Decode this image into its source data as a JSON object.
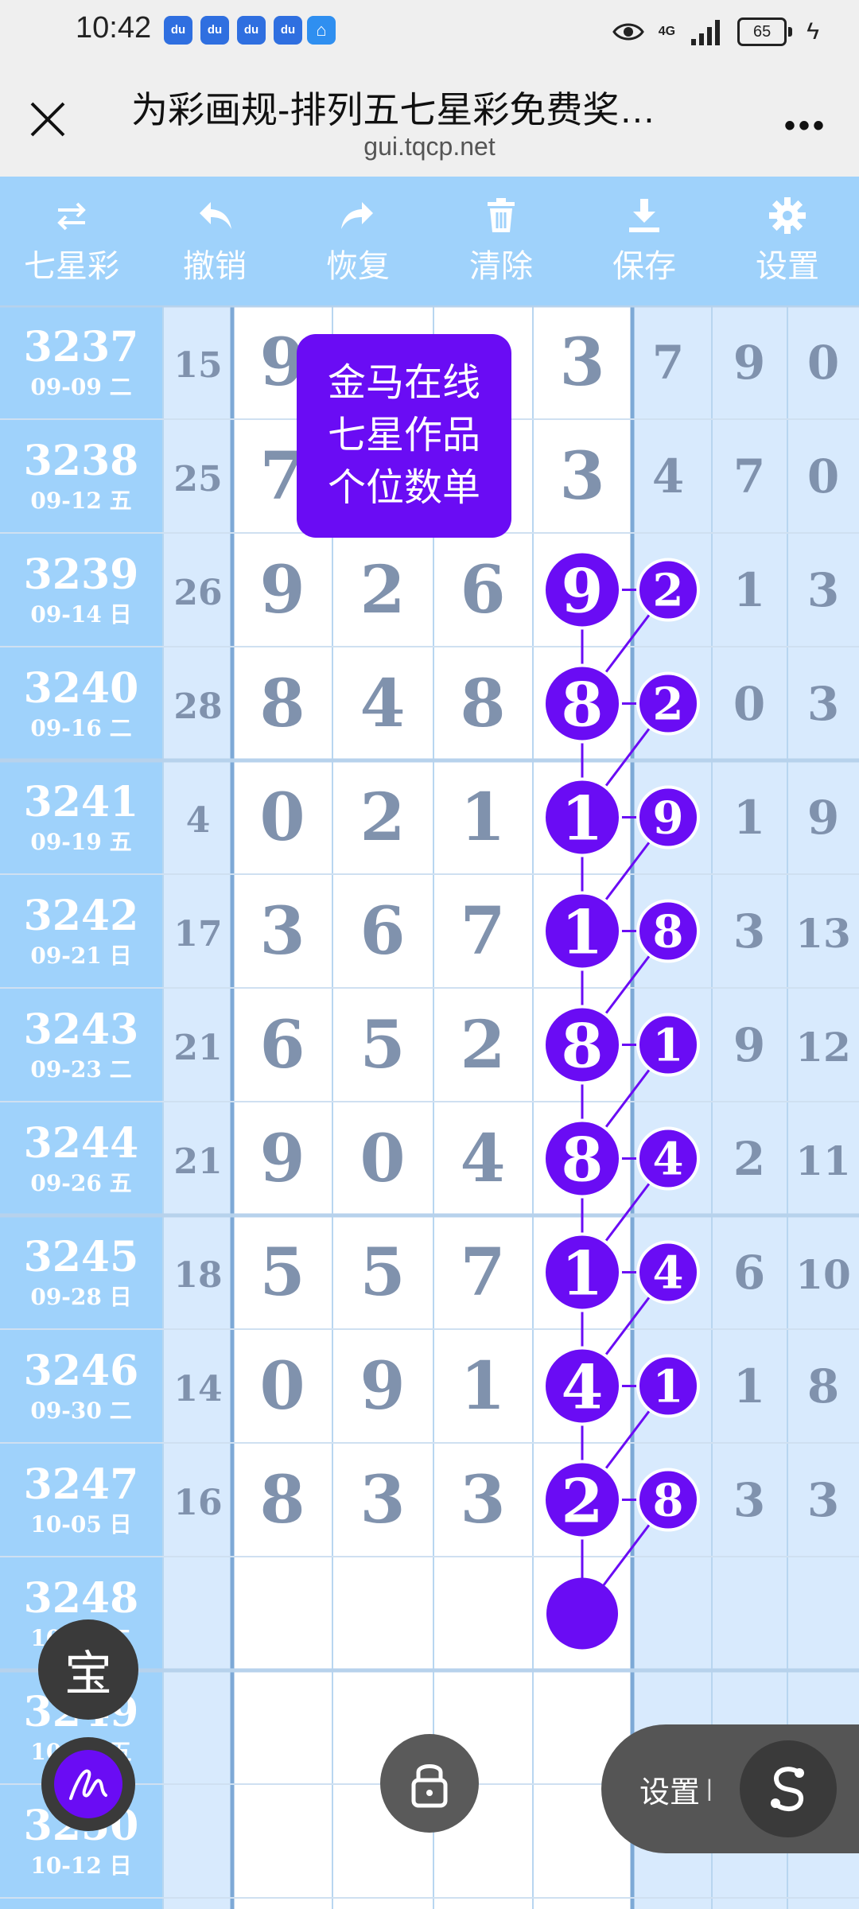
{
  "status_bar": {
    "time": "10:42",
    "notification_icons": [
      "baidu-app-icon",
      "baidu-app-icon",
      "baidu-app-icon",
      "baidu-app-icon",
      "home-icon"
    ],
    "network": "4G",
    "battery": "65"
  },
  "browser": {
    "title": "为彩画规-排列五七星彩免费奖…",
    "url": "gui.tqcp.net"
  },
  "toolbar": {
    "items": [
      {
        "label": "七星彩",
        "icon": "swap-icon"
      },
      {
        "label": "撤销",
        "icon": "undo-icon"
      },
      {
        "label": "恢复",
        "icon": "redo-icon"
      },
      {
        "label": "清除",
        "icon": "trash-icon"
      },
      {
        "label": "保存",
        "icon": "download-icon"
      },
      {
        "label": "设置",
        "icon": "gear-icon"
      }
    ]
  },
  "promo": {
    "lines": [
      "金马在线",
      "七星作品",
      "个位数单"
    ]
  },
  "colors": {
    "toolbar_bg": "#9fd2fb",
    "issue_col_bg": "#9fd2fb",
    "light_col_bg": "#d8eafd",
    "accent_purple": "#6a0cf4",
    "digit_gray": "#8092ad"
  },
  "table": {
    "rows": [
      {
        "issue": "3237",
        "date": "09-09 二",
        "sum": "15",
        "d": [
          "9",
          "",
          "",
          "3"
        ],
        "marked": false,
        "s": "7",
        "a": "9",
        "b": "0"
      },
      {
        "issue": "3238",
        "date": "09-12 五",
        "sum": "25",
        "d": [
          "7",
          "",
          "",
          "3"
        ],
        "marked": false,
        "s": "4",
        "a": "7",
        "b": "0"
      },
      {
        "issue": "3239",
        "date": "09-14 日",
        "sum": "26",
        "d": [
          "9",
          "2",
          "6",
          "9"
        ],
        "marked": true,
        "s": "2",
        "a": "1",
        "b": "3"
      },
      {
        "issue": "3240",
        "date": "09-16 二",
        "sum": "28",
        "d": [
          "8",
          "4",
          "8",
          "8"
        ],
        "marked": true,
        "s": "2",
        "a": "0",
        "b": "3"
      },
      {
        "issue": "3241",
        "date": "09-19 五",
        "sum": "4",
        "d": [
          "0",
          "2",
          "1",
          "1"
        ],
        "marked": true,
        "s": "9",
        "a": "1",
        "b": "9"
      },
      {
        "issue": "3242",
        "date": "09-21 日",
        "sum": "17",
        "d": [
          "3",
          "6",
          "7",
          "1"
        ],
        "marked": true,
        "s": "8",
        "a": "3",
        "b": "13"
      },
      {
        "issue": "3243",
        "date": "09-23 二",
        "sum": "21",
        "d": [
          "6",
          "5",
          "2",
          "8"
        ],
        "marked": true,
        "s": "1",
        "a": "9",
        "b": "12"
      },
      {
        "issue": "3244",
        "date": "09-26 五",
        "sum": "21",
        "d": [
          "9",
          "0",
          "4",
          "8"
        ],
        "marked": true,
        "s": "4",
        "a": "2",
        "b": "11"
      },
      {
        "issue": "3245",
        "date": "09-28 日",
        "sum": "18",
        "d": [
          "5",
          "5",
          "7",
          "1"
        ],
        "marked": true,
        "s": "4",
        "a": "6",
        "b": "10"
      },
      {
        "issue": "3246",
        "date": "09-30 二",
        "sum": "14",
        "d": [
          "0",
          "9",
          "1",
          "4"
        ],
        "marked": true,
        "s": "1",
        "a": "1",
        "b": "8"
      },
      {
        "issue": "3247",
        "date": "10-05 日",
        "sum": "16",
        "d": [
          "8",
          "3",
          "3",
          "2"
        ],
        "marked": true,
        "s": "8",
        "a": "3",
        "b": "3"
      },
      {
        "issue": "3248",
        "date": "10-07 二",
        "sum": "",
        "d": [
          "",
          "",
          "",
          ""
        ],
        "marked": false,
        "s": "",
        "a": "",
        "b": ""
      },
      {
        "issue": "3249",
        "date": "10-10 五",
        "sum": "",
        "d": [
          "",
          "",
          "",
          ""
        ],
        "marked": false,
        "s": "",
        "a": "",
        "b": ""
      },
      {
        "issue": "3250",
        "date": "10-12 日",
        "sum": "",
        "d": [
          "",
          "",
          "",
          ""
        ],
        "marked": false,
        "s": "",
        "a": "",
        "b": ""
      }
    ]
  },
  "floating": {
    "bao_label": "宝",
    "settings_label": "设置",
    "settings_sep": "|"
  }
}
